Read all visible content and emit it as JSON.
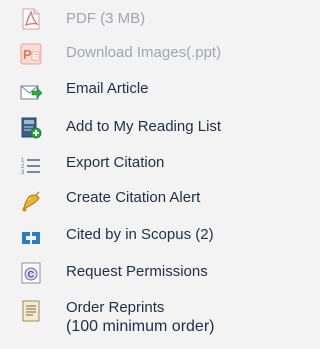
{
  "colors": {
    "background": "#f3f3f3",
    "link_text": "#1e2f46",
    "disabled_text": "#a2a6ab"
  },
  "menu": {
    "items": [
      {
        "label": "PDF (3 MB)",
        "icon": "pdf-icon",
        "enabled": false
      },
      {
        "label": "Download Images(.ppt)",
        "icon": "powerpoint-icon",
        "enabled": false
      },
      {
        "label": "Email Article",
        "icon": "email-icon",
        "enabled": true
      },
      {
        "label": "Add to My Reading List",
        "icon": "reading-list-icon",
        "enabled": true
      },
      {
        "label": "Export Citation",
        "icon": "numbered-list-icon",
        "enabled": true
      },
      {
        "label": "Create Citation Alert",
        "icon": "bell-icon",
        "enabled": true
      },
      {
        "label": "Cited by in Scopus (2)",
        "icon": "scopus-icon",
        "enabled": true
      },
      {
        "label": "Request Permissions",
        "icon": "copyright-icon",
        "enabled": true
      },
      {
        "label": "Order Reprints",
        "sublabel": "(100 minimum order)",
        "icon": "document-icon",
        "enabled": true
      }
    ]
  }
}
